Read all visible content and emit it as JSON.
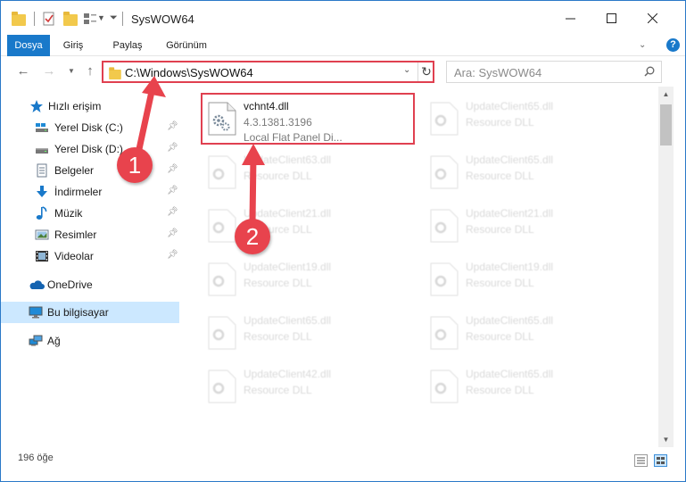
{
  "window": {
    "title": "SysWOW64",
    "accent": "#1979ca",
    "annotation_color": "#e04050"
  },
  "ribbon": {
    "tabs": [
      {
        "label": "Dosya"
      },
      {
        "label": "Giriş"
      },
      {
        "label": "Paylaş"
      },
      {
        "label": "Görünüm"
      }
    ],
    "help_label": "?"
  },
  "address": {
    "path": "C:\\Windows\\SysWOW64"
  },
  "search": {
    "placeholder": "Ara: SysWOW64"
  },
  "nav": {
    "quick_access": "Hızlı erişim",
    "items": [
      {
        "label": "Yerel Disk (C:)",
        "icon": "drive-icon"
      },
      {
        "label": "Yerel Disk (D:)",
        "icon": "drive-icon"
      },
      {
        "label": "Belgeler",
        "icon": "documents-icon"
      },
      {
        "label": "İndirmeler",
        "icon": "downloads-icon"
      },
      {
        "label": "Müzik",
        "icon": "music-icon"
      },
      {
        "label": "Resimler",
        "icon": "pictures-icon"
      },
      {
        "label": "Videolar",
        "icon": "videos-icon"
      }
    ],
    "onedrive": "OneDrive",
    "this_pc": "Bu bilgisayar",
    "network": "Ağ"
  },
  "files": {
    "highlighted": {
      "name": "vchnt4.dll",
      "version": "4.3.1381.3196",
      "description": "Local Flat Panel Di..."
    },
    "faded": [
      {
        "name": "UpdateClient65.dll",
        "type": "Resource DLL"
      },
      {
        "name": "UpdateClient63.dll",
        "type": "Resource DLL"
      },
      {
        "name": "UpdateClient65.dll",
        "type": "Resource DLL"
      },
      {
        "name": "UpdateClient21.dll",
        "type": "Resource DLL"
      },
      {
        "name": "UpdateClient21.dll",
        "type": "Resource DLL"
      },
      {
        "name": "UpdateClient19.dll",
        "type": "Resource DLL"
      },
      {
        "name": "UpdateClient19.dll",
        "type": "Resource DLL"
      },
      {
        "name": "UpdateClient65.dll",
        "type": "Resource DLL"
      },
      {
        "name": "UpdateClient65.dll",
        "type": "Resource DLL"
      },
      {
        "name": "UpdateClient42.dll",
        "type": "Resource DLL"
      },
      {
        "name": "UpdateClient65.dll",
        "type": "Resource DLL"
      }
    ]
  },
  "status": {
    "item_count": "196 öğe"
  },
  "annotations": {
    "step1": "1",
    "step2": "2"
  }
}
